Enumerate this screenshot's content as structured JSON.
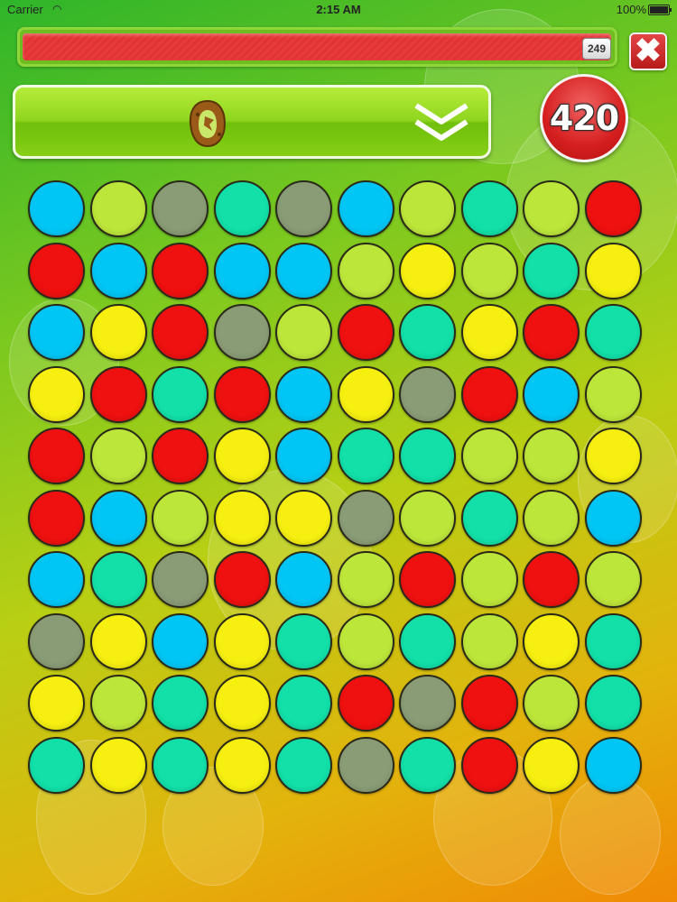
{
  "status_bar": {
    "carrier": "Carrier",
    "time": "2:15 AM",
    "battery": "100%"
  },
  "timer": {
    "remaining": "249",
    "fill_fraction": 1.0
  },
  "score": "420",
  "icons": {
    "close": "close-icon",
    "level": "level-icon",
    "expand": "double-chevron-down-icon"
  },
  "colors": {
    "cyan": "#00c6f5",
    "lime": "#bde63a",
    "gray": "#8a9c76",
    "teal": "#12e0a8",
    "red": "#ef1010",
    "yellow": "#f6ef10"
  },
  "grid": [
    [
      "cyan",
      "lime",
      "gray",
      "teal",
      "gray",
      "cyan",
      "lime",
      "teal",
      "lime",
      "red"
    ],
    [
      "red",
      "cyan",
      "red",
      "cyan",
      "cyan",
      "lime",
      "yellow",
      "lime",
      "teal",
      "yellow"
    ],
    [
      "cyan",
      "yellow",
      "red",
      "gray",
      "lime",
      "red",
      "teal",
      "yellow",
      "red",
      "teal"
    ],
    [
      "yellow",
      "red",
      "teal",
      "red",
      "cyan",
      "yellow",
      "gray",
      "red",
      "cyan",
      "lime"
    ],
    [
      "red",
      "lime",
      "red",
      "yellow",
      "cyan",
      "teal",
      "teal",
      "lime",
      "lime",
      "yellow"
    ],
    [
      "red",
      "cyan",
      "lime",
      "yellow",
      "yellow",
      "gray",
      "lime",
      "teal",
      "lime",
      "cyan"
    ],
    [
      "cyan",
      "teal",
      "gray",
      "red",
      "cyan",
      "lime",
      "red",
      "lime",
      "red",
      "lime"
    ],
    [
      "gray",
      "yellow",
      "cyan",
      "yellow",
      "teal",
      "lime",
      "teal",
      "lime",
      "yellow",
      "teal"
    ],
    [
      "yellow",
      "lime",
      "teal",
      "yellow",
      "teal",
      "red",
      "gray",
      "red",
      "lime",
      "teal"
    ],
    [
      "teal",
      "yellow",
      "teal",
      "yellow",
      "teal",
      "gray",
      "teal",
      "red",
      "yellow",
      "cyan"
    ]
  ]
}
